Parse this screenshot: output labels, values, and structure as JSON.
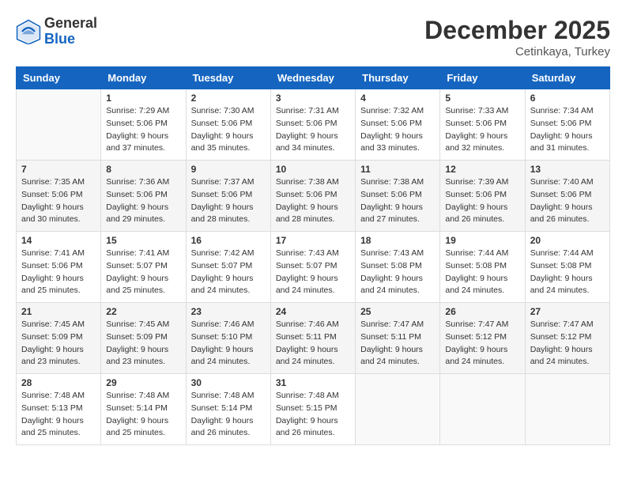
{
  "logo": {
    "general": "General",
    "blue": "Blue"
  },
  "header": {
    "month": "December 2025",
    "location": "Cetinkaya, Turkey"
  },
  "weekdays": [
    "Sunday",
    "Monday",
    "Tuesday",
    "Wednesday",
    "Thursday",
    "Friday",
    "Saturday"
  ],
  "weeks": [
    [
      {
        "day": "",
        "sunrise": "",
        "sunset": "",
        "daylight": "",
        "empty": true
      },
      {
        "day": "1",
        "sunrise": "Sunrise: 7:29 AM",
        "sunset": "Sunset: 5:06 PM",
        "daylight": "Daylight: 9 hours and 37 minutes."
      },
      {
        "day": "2",
        "sunrise": "Sunrise: 7:30 AM",
        "sunset": "Sunset: 5:06 PM",
        "daylight": "Daylight: 9 hours and 35 minutes."
      },
      {
        "day": "3",
        "sunrise": "Sunrise: 7:31 AM",
        "sunset": "Sunset: 5:06 PM",
        "daylight": "Daylight: 9 hours and 34 minutes."
      },
      {
        "day": "4",
        "sunrise": "Sunrise: 7:32 AM",
        "sunset": "Sunset: 5:06 PM",
        "daylight": "Daylight: 9 hours and 33 minutes."
      },
      {
        "day": "5",
        "sunrise": "Sunrise: 7:33 AM",
        "sunset": "Sunset: 5:06 PM",
        "daylight": "Daylight: 9 hours and 32 minutes."
      },
      {
        "day": "6",
        "sunrise": "Sunrise: 7:34 AM",
        "sunset": "Sunset: 5:06 PM",
        "daylight": "Daylight: 9 hours and 31 minutes."
      }
    ],
    [
      {
        "day": "7",
        "sunrise": "Sunrise: 7:35 AM",
        "sunset": "Sunset: 5:06 PM",
        "daylight": "Daylight: 9 hours and 30 minutes."
      },
      {
        "day": "8",
        "sunrise": "Sunrise: 7:36 AM",
        "sunset": "Sunset: 5:06 PM",
        "daylight": "Daylight: 9 hours and 29 minutes."
      },
      {
        "day": "9",
        "sunrise": "Sunrise: 7:37 AM",
        "sunset": "Sunset: 5:06 PM",
        "daylight": "Daylight: 9 hours and 28 minutes."
      },
      {
        "day": "10",
        "sunrise": "Sunrise: 7:38 AM",
        "sunset": "Sunset: 5:06 PM",
        "daylight": "Daylight: 9 hours and 28 minutes."
      },
      {
        "day": "11",
        "sunrise": "Sunrise: 7:38 AM",
        "sunset": "Sunset: 5:06 PM",
        "daylight": "Daylight: 9 hours and 27 minutes."
      },
      {
        "day": "12",
        "sunrise": "Sunrise: 7:39 AM",
        "sunset": "Sunset: 5:06 PM",
        "daylight": "Daylight: 9 hours and 26 minutes."
      },
      {
        "day": "13",
        "sunrise": "Sunrise: 7:40 AM",
        "sunset": "Sunset: 5:06 PM",
        "daylight": "Daylight: 9 hours and 26 minutes."
      }
    ],
    [
      {
        "day": "14",
        "sunrise": "Sunrise: 7:41 AM",
        "sunset": "Sunset: 5:06 PM",
        "daylight": "Daylight: 9 hours and 25 minutes."
      },
      {
        "day": "15",
        "sunrise": "Sunrise: 7:41 AM",
        "sunset": "Sunset: 5:07 PM",
        "daylight": "Daylight: 9 hours and 25 minutes."
      },
      {
        "day": "16",
        "sunrise": "Sunrise: 7:42 AM",
        "sunset": "Sunset: 5:07 PM",
        "daylight": "Daylight: 9 hours and 24 minutes."
      },
      {
        "day": "17",
        "sunrise": "Sunrise: 7:43 AM",
        "sunset": "Sunset: 5:07 PM",
        "daylight": "Daylight: 9 hours and 24 minutes."
      },
      {
        "day": "18",
        "sunrise": "Sunrise: 7:43 AM",
        "sunset": "Sunset: 5:08 PM",
        "daylight": "Daylight: 9 hours and 24 minutes."
      },
      {
        "day": "19",
        "sunrise": "Sunrise: 7:44 AM",
        "sunset": "Sunset: 5:08 PM",
        "daylight": "Daylight: 9 hours and 24 minutes."
      },
      {
        "day": "20",
        "sunrise": "Sunrise: 7:44 AM",
        "sunset": "Sunset: 5:08 PM",
        "daylight": "Daylight: 9 hours and 24 minutes."
      }
    ],
    [
      {
        "day": "21",
        "sunrise": "Sunrise: 7:45 AM",
        "sunset": "Sunset: 5:09 PM",
        "daylight": "Daylight: 9 hours and 23 minutes."
      },
      {
        "day": "22",
        "sunrise": "Sunrise: 7:45 AM",
        "sunset": "Sunset: 5:09 PM",
        "daylight": "Daylight: 9 hours and 23 minutes."
      },
      {
        "day": "23",
        "sunrise": "Sunrise: 7:46 AM",
        "sunset": "Sunset: 5:10 PM",
        "daylight": "Daylight: 9 hours and 24 minutes."
      },
      {
        "day": "24",
        "sunrise": "Sunrise: 7:46 AM",
        "sunset": "Sunset: 5:11 PM",
        "daylight": "Daylight: 9 hours and 24 minutes."
      },
      {
        "day": "25",
        "sunrise": "Sunrise: 7:47 AM",
        "sunset": "Sunset: 5:11 PM",
        "daylight": "Daylight: 9 hours and 24 minutes."
      },
      {
        "day": "26",
        "sunrise": "Sunrise: 7:47 AM",
        "sunset": "Sunset: 5:12 PM",
        "daylight": "Daylight: 9 hours and 24 minutes."
      },
      {
        "day": "27",
        "sunrise": "Sunrise: 7:47 AM",
        "sunset": "Sunset: 5:12 PM",
        "daylight": "Daylight: 9 hours and 24 minutes."
      }
    ],
    [
      {
        "day": "28",
        "sunrise": "Sunrise: 7:48 AM",
        "sunset": "Sunset: 5:13 PM",
        "daylight": "Daylight: 9 hours and 25 minutes."
      },
      {
        "day": "29",
        "sunrise": "Sunrise: 7:48 AM",
        "sunset": "Sunset: 5:14 PM",
        "daylight": "Daylight: 9 hours and 25 minutes."
      },
      {
        "day": "30",
        "sunrise": "Sunrise: 7:48 AM",
        "sunset": "Sunset: 5:14 PM",
        "daylight": "Daylight: 9 hours and 26 minutes."
      },
      {
        "day": "31",
        "sunrise": "Sunrise: 7:48 AM",
        "sunset": "Sunset: 5:15 PM",
        "daylight": "Daylight: 9 hours and 26 minutes."
      },
      {
        "day": "",
        "empty": true
      },
      {
        "day": "",
        "empty": true
      },
      {
        "day": "",
        "empty": true
      }
    ]
  ]
}
